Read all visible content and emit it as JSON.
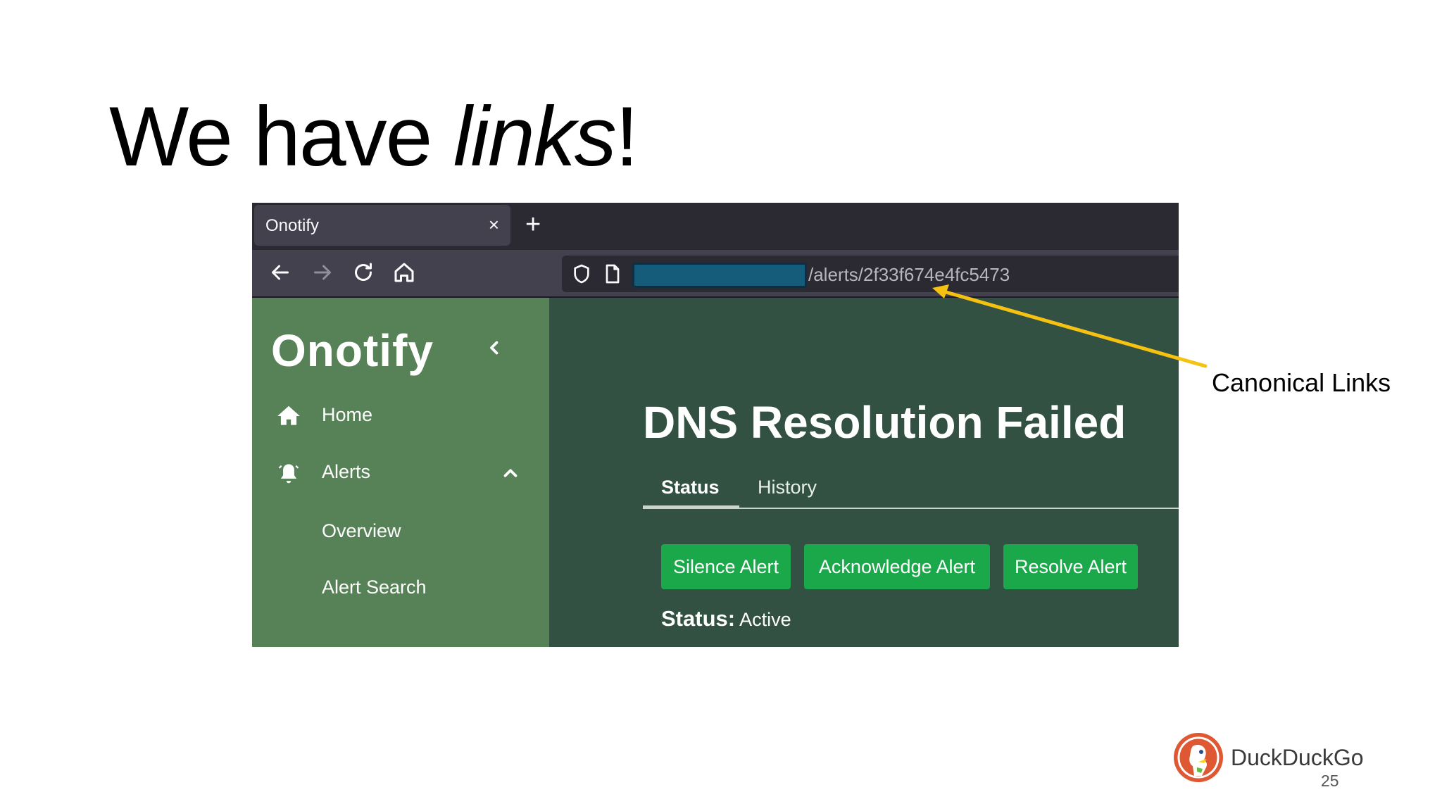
{
  "slide": {
    "title_prefix": "We have ",
    "title_emph": "links",
    "title_suffix": "!",
    "annotation": "Canonical Links",
    "footer_brand": "DuckDuckGo",
    "page_number": "25"
  },
  "browser": {
    "tab_title": "Onotify",
    "tab_close": "×",
    "new_tab": "+",
    "url_path": "/alerts/2f33f674e4fc5473"
  },
  "sidebar": {
    "brand": "Onotify",
    "items": [
      {
        "label": "Home",
        "icon": "home-icon"
      },
      {
        "label": "Alerts",
        "icon": "bell-icon",
        "expanded": true
      }
    ],
    "sub_items": [
      {
        "label": "Overview"
      },
      {
        "label": "Alert Search"
      }
    ]
  },
  "main": {
    "title": "DNS Resolution Failed",
    "tabs": [
      {
        "label": "Status",
        "active": true
      },
      {
        "label": "History",
        "active": false
      }
    ],
    "buttons": [
      {
        "label": "Silence Alert"
      },
      {
        "label": "Acknowledge Alert"
      },
      {
        "label": "Resolve Alert"
      }
    ],
    "status_label": "Status:",
    "status_value": "Active"
  },
  "colors": {
    "sidebar_bg": "#578257",
    "main_bg": "#335143",
    "button_bg": "#1aa84a",
    "arrow": "#f5c211",
    "redaction": "#155b7a"
  }
}
